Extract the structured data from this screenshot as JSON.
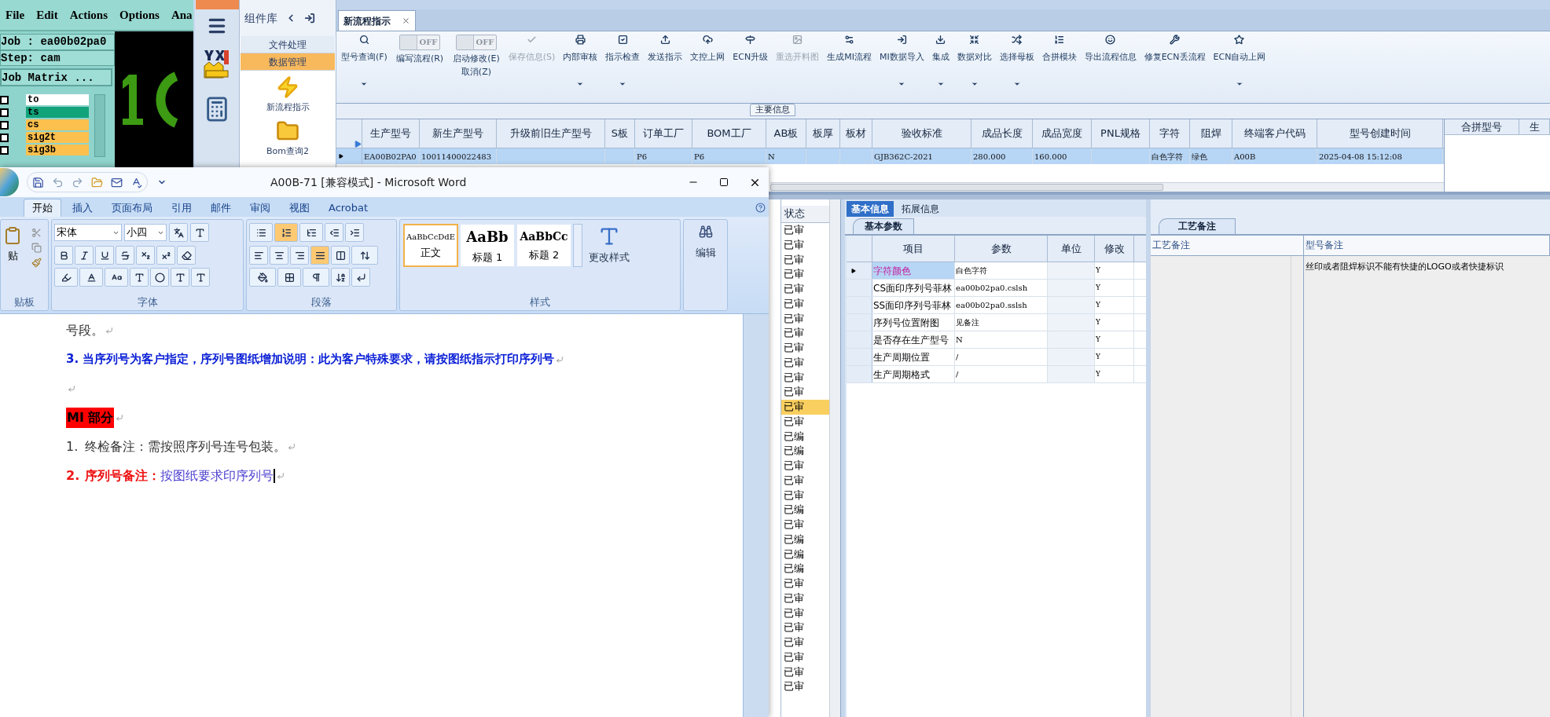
{
  "cam": {
    "menu": [
      "File",
      "Edit",
      "Actions",
      "Options",
      "Ana"
    ],
    "job": "Job : ea00b02pa0",
    "step": "Step: cam",
    "matrix_button": "Job Matrix ...",
    "layers": [
      {
        "name": "to",
        "color": "#ffffff",
        "checked": false
      },
      {
        "name": "ts",
        "color": "#12a37a",
        "checked": false
      },
      {
        "name": "cs",
        "color": "#fbc04e",
        "checked": false
      },
      {
        "name": "sig2t",
        "color": "#fbc04e",
        "checked": false
      },
      {
        "name": "sig3b",
        "color": "#fbc04e",
        "checked": false
      }
    ]
  },
  "erp": {
    "sidebar": {
      "title": "组件库",
      "sections": [
        {
          "label": "文件处理",
          "selected": false
        },
        {
          "label": "数据管理",
          "selected": true
        }
      ],
      "items": [
        {
          "label": "新流程指示",
          "kind": "flash"
        },
        {
          "label": "Bom查询2",
          "kind": "folder"
        }
      ]
    },
    "doc_tab": {
      "label": "新流程指示",
      "selected": true
    },
    "toolbar": [
      {
        "kind": "button",
        "label": "型号查询(F)",
        "dropdown": true,
        "disabled": false
      },
      {
        "kind": "toggle",
        "label": "编写流程(R)",
        "switch_text": "OFF",
        "on": false
      },
      {
        "kind": "toggle",
        "label": "启动修改(E)",
        "sublabel": "取消(Z)",
        "switch_text": "OFF",
        "on": false
      },
      {
        "kind": "button",
        "label": "保存信息(S)",
        "dropdown": false,
        "disabled": true
      },
      {
        "kind": "button",
        "label": "内部审核",
        "dropdown": true,
        "disabled": false
      },
      {
        "kind": "button",
        "label": "指示检查",
        "dropdown": true,
        "disabled": false
      },
      {
        "kind": "button",
        "label": "发送指示",
        "dropdown": false,
        "disabled": false
      },
      {
        "kind": "button",
        "label": "文控上网",
        "dropdown": false,
        "disabled": false
      },
      {
        "kind": "button",
        "label": "ECN升级",
        "dropdown": false,
        "disabled": false
      },
      {
        "kind": "button",
        "label": "重选开料图",
        "dropdown": false,
        "disabled": true
      },
      {
        "kind": "button",
        "label": "生成MI流程",
        "dropdown": false,
        "disabled": false
      },
      {
        "kind": "button",
        "label": "MI数据导入",
        "dropdown": true,
        "disabled": false
      },
      {
        "kind": "button",
        "label": "集成",
        "dropdown": true,
        "disabled": false
      },
      {
        "kind": "button",
        "label": "数据对比",
        "dropdown": true,
        "disabled": false
      },
      {
        "kind": "button",
        "label": "选择母板",
        "dropdown": true,
        "disabled": false
      },
      {
        "kind": "button",
        "label": "合拼模块",
        "dropdown": false,
        "disabled": false
      },
      {
        "kind": "button",
        "label": "导出流程信息",
        "dropdown": false,
        "disabled": false
      },
      {
        "kind": "button",
        "label": "修复ECN丢流程",
        "dropdown": false,
        "disabled": false
      },
      {
        "kind": "button",
        "label": "ECN自动上网",
        "dropdown": true,
        "disabled": false
      }
    ],
    "main_group": "主要信息",
    "table": {
      "columns": [
        "生产型号",
        "新生产型号",
        "升级前旧生产型号",
        "S板",
        "订单工厂",
        "BOM工厂",
        "AB板",
        "板厚",
        "板材",
        "验收标准",
        "成品长度",
        "成品宽度",
        "PNL规格",
        "字符",
        "阻焊",
        "终端客户代码",
        "型号创建时间"
      ],
      "rows": [
        {
          "selected": true,
          "cells": [
            "EA00B02PA0",
            "10011400022483",
            null,
            null,
            "P6",
            "P6",
            "N",
            null,
            null,
            "GJB362C-2021",
            "280.000",
            "160.000",
            null,
            "白色字符",
            "绿色",
            "A00B",
            "2025-04-08 15:12:08"
          ]
        }
      ]
    },
    "merge_table": {
      "columns": [
        "合拼型号",
        "生"
      ]
    },
    "status_list": {
      "header": "状态",
      "rows": [
        {
          "text": "已审",
          "selected": false
        },
        {
          "text": "已审",
          "selected": false
        },
        {
          "text": "已审",
          "selected": false
        },
        {
          "text": "已审",
          "selected": false
        },
        {
          "text": "已审",
          "selected": false
        },
        {
          "text": "已审",
          "selected": false
        },
        {
          "text": "已审",
          "selected": false
        },
        {
          "text": "已审",
          "selected": false
        },
        {
          "text": "已审",
          "selected": false
        },
        {
          "text": "已审",
          "selected": false
        },
        {
          "text": "已审",
          "selected": false
        },
        {
          "text": "已审",
          "selected": false
        },
        {
          "text": "已审",
          "selected": true
        },
        {
          "text": "已审",
          "selected": false
        },
        {
          "text": "已编",
          "selected": false
        },
        {
          "text": "已编",
          "selected": false
        },
        {
          "text": "已审",
          "selected": false
        },
        {
          "text": "已审",
          "selected": false
        },
        {
          "text": "已审",
          "selected": false
        },
        {
          "text": "已编",
          "selected": false
        },
        {
          "text": "已审",
          "selected": false
        },
        {
          "text": "已编",
          "selected": false
        },
        {
          "text": "已编",
          "selected": false
        },
        {
          "text": "已编",
          "selected": false
        },
        {
          "text": "已审",
          "selected": false
        },
        {
          "text": "已审",
          "selected": false
        },
        {
          "text": "已审",
          "selected": false
        },
        {
          "text": "已审",
          "selected": false
        },
        {
          "text": "已审",
          "selected": false
        },
        {
          "text": "已审",
          "selected": false
        },
        {
          "text": "已审",
          "selected": false
        },
        {
          "text": "已审",
          "selected": false
        }
      ]
    },
    "info_tabs": [
      {
        "label": "基本信息",
        "selected": true
      },
      {
        "label": "拓展信息",
        "selected": false
      }
    ],
    "params": {
      "tab": "基本参数",
      "columns": [
        "项目",
        "参数",
        "单位",
        "修改"
      ],
      "rows": [
        {
          "selected": true,
          "cells": [
            "字符颜色",
            "白色字符",
            null,
            "Y"
          ]
        },
        {
          "selected": false,
          "cells": [
            "CS面印序列号菲林",
            "ea00b02pa0.cslsh",
            null,
            "Y"
          ]
        },
        {
          "selected": false,
          "cells": [
            "SS面印序列号菲林",
            "ea00b02pa0.sslsh",
            null,
            "Y"
          ]
        },
        {
          "selected": false,
          "cells": [
            "序列号位置附图",
            "见备注",
            null,
            "Y"
          ]
        },
        {
          "selected": false,
          "cells": [
            "是否存在生产型号",
            "N",
            null,
            "Y"
          ]
        },
        {
          "selected": false,
          "cells": [
            "生产周期位置",
            "/",
            null,
            "Y"
          ]
        },
        {
          "selected": false,
          "cells": [
            "生产周期格式",
            "/",
            null,
            "Y"
          ]
        }
      ]
    },
    "notes": {
      "tab": "工艺备注",
      "columns": [
        "工艺备注",
        "型号备注"
      ],
      "text": "丝印或者阻焊标识不能有快捷的LOGO或者快捷标识"
    }
  },
  "word": {
    "title": "A00B-71 [兼容模式] - Microsoft Word",
    "tabs": [
      {
        "label": "开始",
        "selected": true
      },
      {
        "label": "插入",
        "selected": false
      },
      {
        "label": "页面布局",
        "selected": false
      },
      {
        "label": "引用",
        "selected": false
      },
      {
        "label": "邮件",
        "selected": false
      },
      {
        "label": "审阅",
        "selected": false
      },
      {
        "label": "视图",
        "selected": false
      },
      {
        "label": "Acrobat",
        "selected": false
      }
    ],
    "clipboard": {
      "paste": "贴",
      "group": "贴板"
    },
    "font": {
      "name": "宋体",
      "size": "小四",
      "group": "字体"
    },
    "paragraph": {
      "group": "段落",
      "numbering_on": true,
      "justify_on": true
    },
    "styles": {
      "group": "样式",
      "change": "更改样式",
      "items": [
        {
          "preview": "AaBbCcDdE",
          "name": "正文",
          "selected": true
        },
        {
          "preview": "AaBb",
          "name": "标题 1",
          "selected": false
        },
        {
          "preview": "AaBbCc",
          "name": "标题 2",
          "selected": false
        }
      ]
    },
    "edit": "编辑",
    "document": [
      {
        "kind": "plain",
        "text": "号段。"
      },
      {
        "kind": "heading",
        "text": "3. 当序列号为客户指定，序列号图纸增加说明：此为客户特殊要求，请按图纸指示打印序列号"
      },
      {
        "kind": "empty"
      },
      {
        "kind": "section",
        "text": "MI 部分"
      },
      {
        "kind": "item",
        "number": "1.",
        "text": "终检备注：需按照序列号连号包装。"
      },
      {
        "kind": "labeled",
        "number": "2.",
        "label": "序列号备注：",
        "text": "按图纸要求印序列号"
      }
    ]
  }
}
